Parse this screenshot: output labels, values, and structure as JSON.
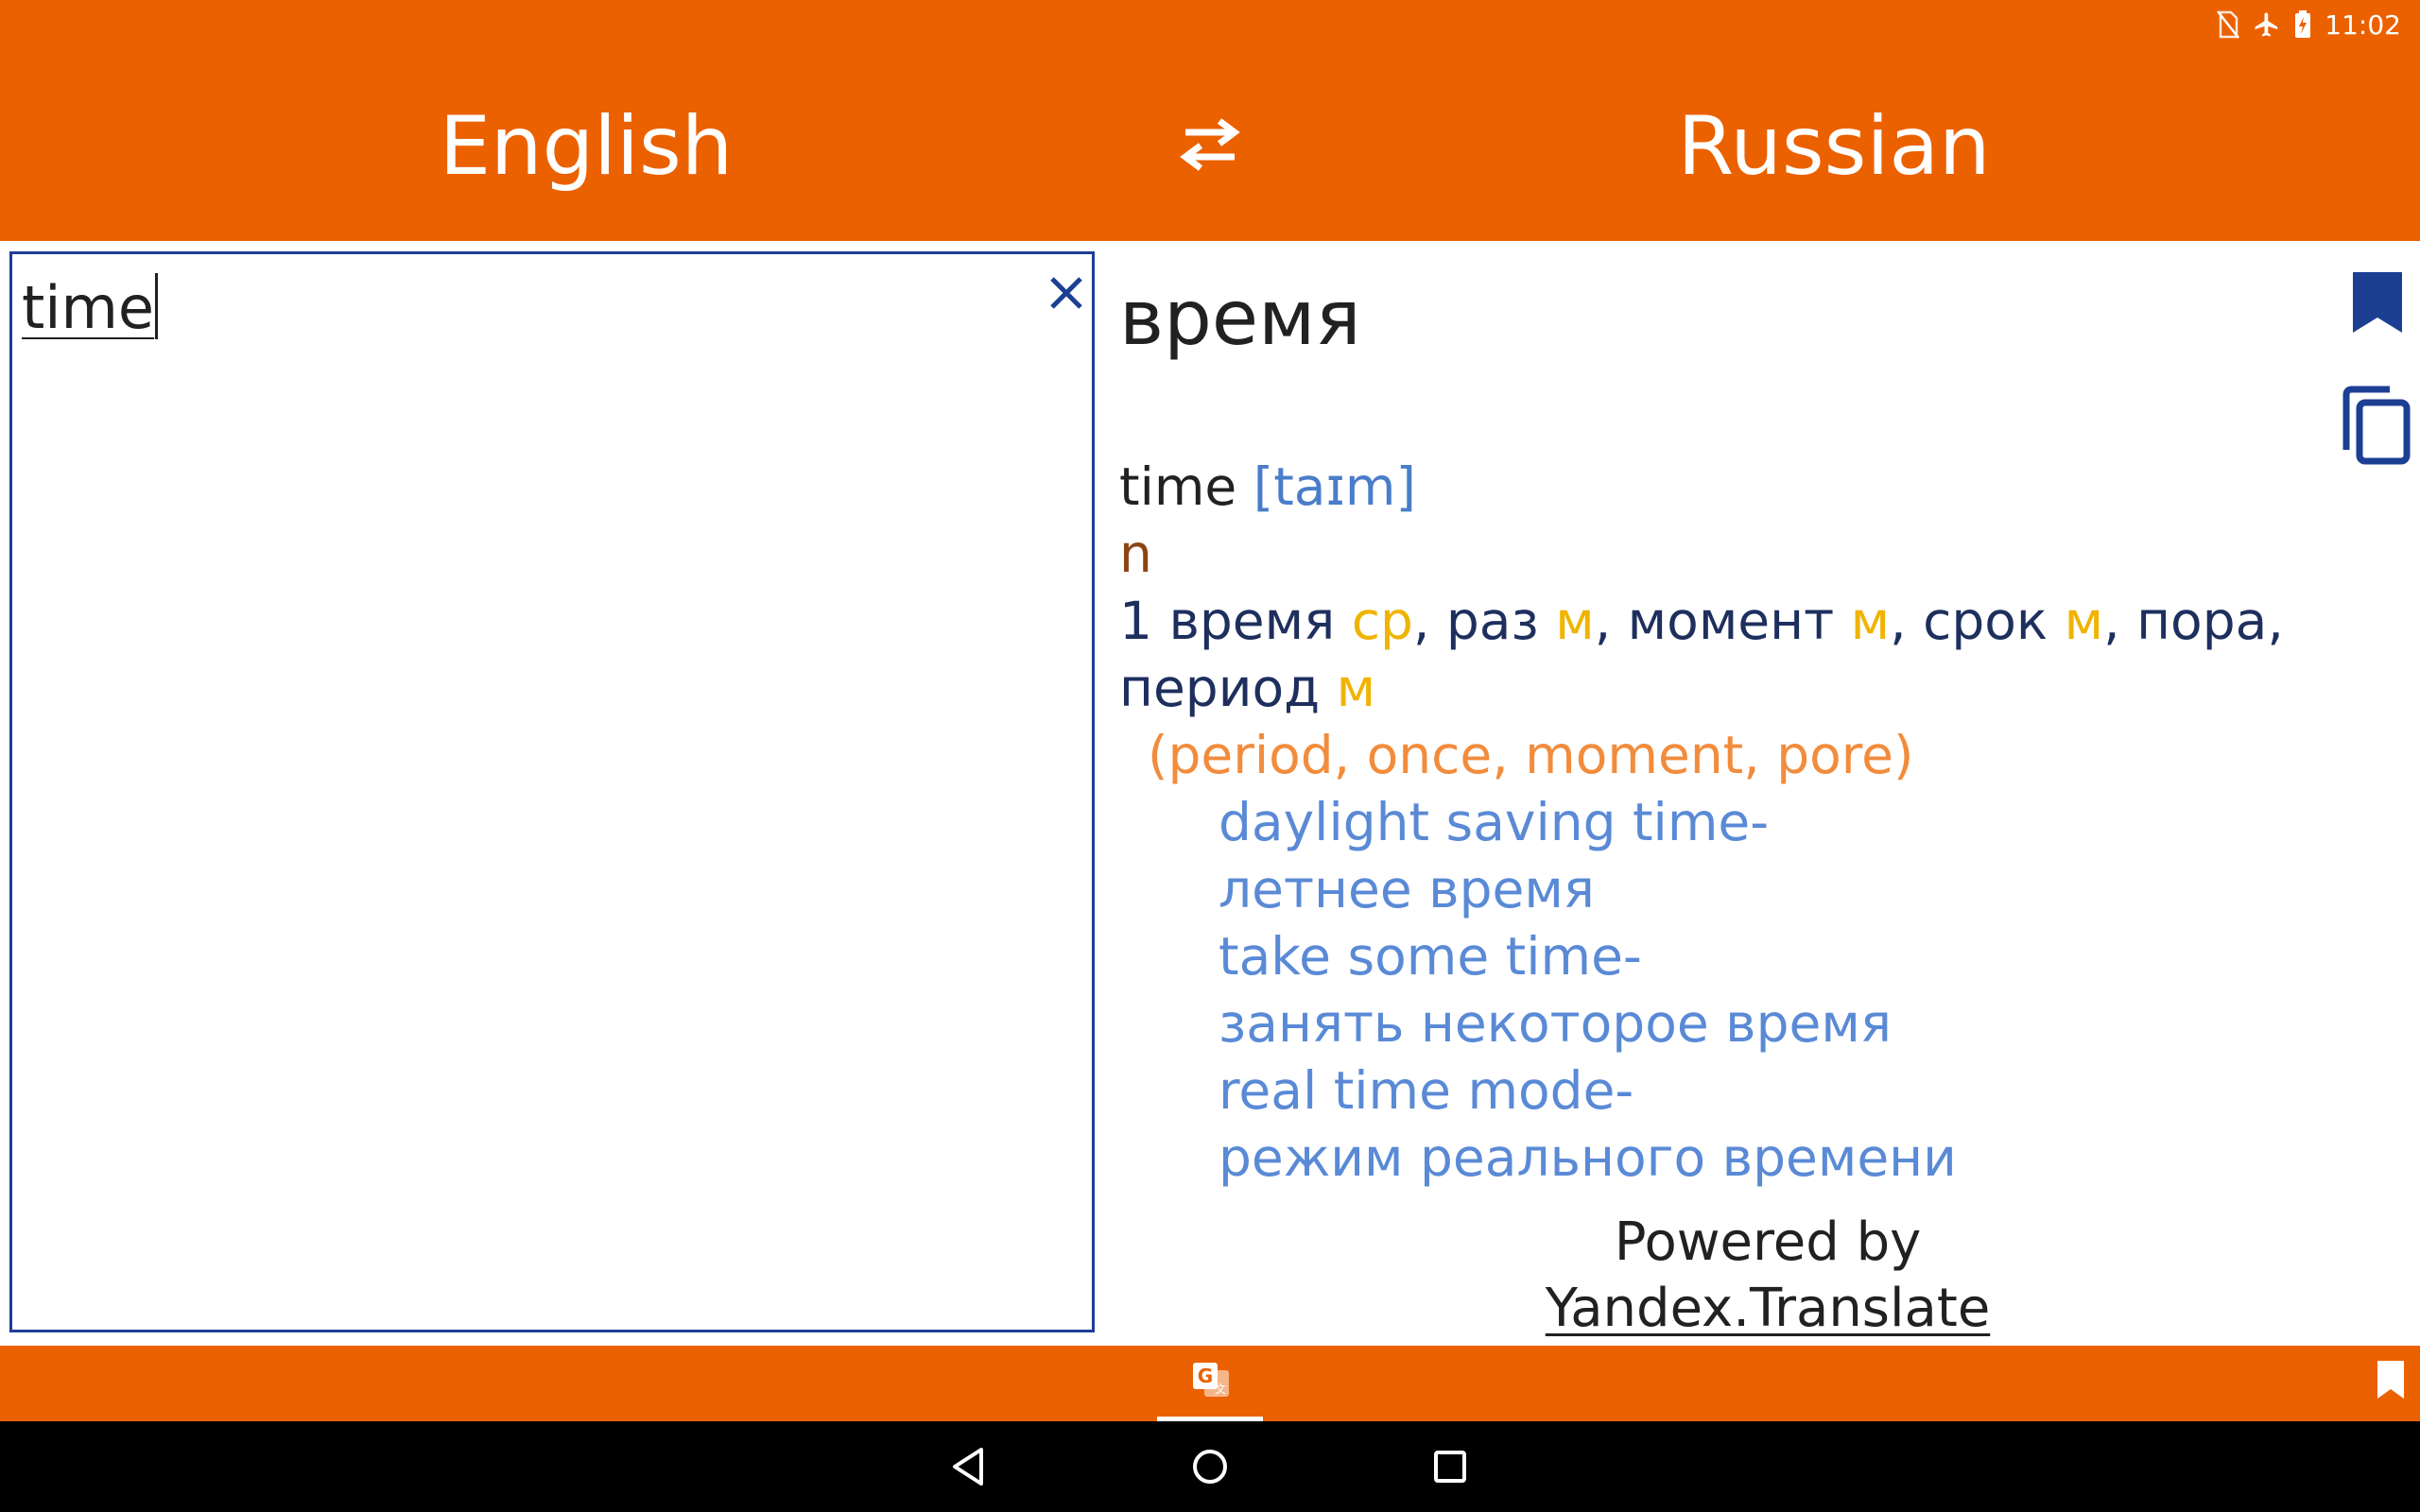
{
  "status_bar": {
    "time": "11:02",
    "icons": [
      "no-sim-icon",
      "airplane-mode-icon",
      "battery-charging-icon"
    ]
  },
  "header": {
    "source_language": "English",
    "target_language": "Russian",
    "swap_icon": "swap-arrows-icon"
  },
  "input": {
    "value": "time",
    "clear_icon": "close-icon"
  },
  "result": {
    "translation": "время",
    "dictionary": {
      "headword": "time",
      "transcription": "[taɪm]",
      "part_of_speech": "n",
      "sense_number": "1",
      "translations": [
        {
          "word": "время",
          "gender": "ср"
        },
        {
          "word": "раз",
          "gender": "м"
        },
        {
          "word": "момент",
          "gender": "м"
        },
        {
          "word": "срок",
          "gender": "м"
        },
        {
          "word": "пора",
          "gender": ""
        },
        {
          "word": "период",
          "gender": "м"
        }
      ],
      "synonyms": "(period, once, moment, pore)",
      "examples": [
        {
          "source": "daylight saving time-",
          "target": "летнее время"
        },
        {
          "source": "take some time-",
          "target": "занять некоторое время"
        },
        {
          "source": "real time mode-",
          "target": "режим реального времени"
        }
      ]
    },
    "bookmark_icon": "bookmark-icon",
    "copy_icon": "copy-icon",
    "powered_by": "Powered by",
    "provider": "Yandex.Translate"
  },
  "bottom_tabs": {
    "translate_icon": "translate-icon",
    "bookmarks_icon": "bookmark-icon"
  },
  "nav_bar": [
    "back-icon",
    "home-icon",
    "recents-icon"
  ],
  "colors": {
    "brand_orange": "#EB6100",
    "input_border": "#1C3F94",
    "translation_text": "#1E2F5E",
    "gender_text": "#F0B400",
    "synonym_text": "#F28C3C",
    "example_text": "#5A8AD6",
    "pos_text": "#8B4513"
  }
}
